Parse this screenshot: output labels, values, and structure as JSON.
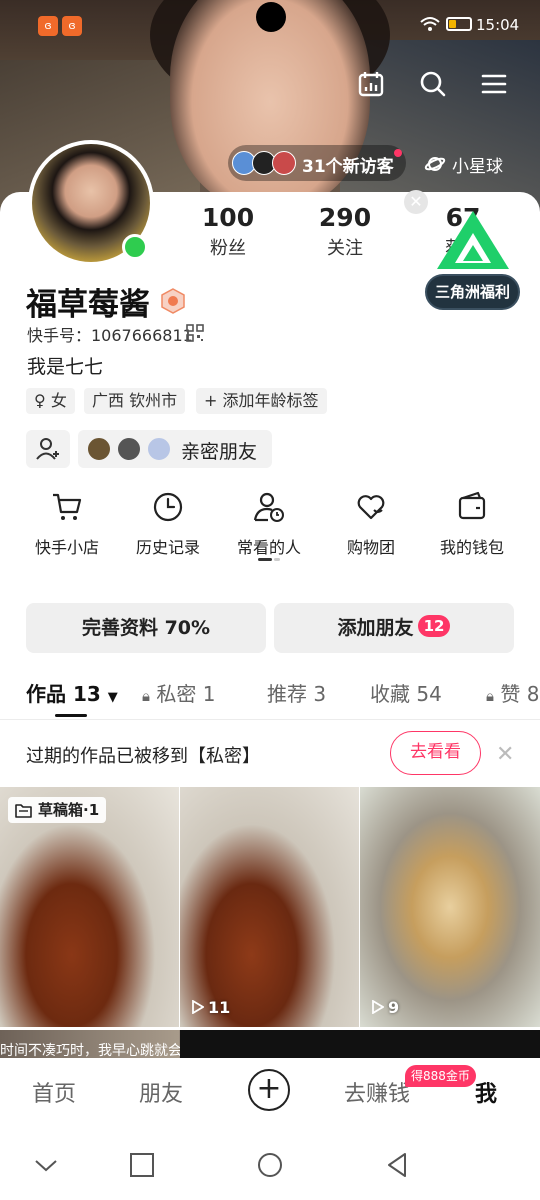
{
  "status_bar": {
    "app_icon_1": "bilibili-icon",
    "app_icon_2": "bilibili-icon",
    "time": "15:04"
  },
  "header": {
    "visitors_label": "31个新访客",
    "planet_label": "小星球"
  },
  "profile": {
    "stats": [
      {
        "value": "100",
        "label": "粉丝"
      },
      {
        "value": "290",
        "label": "关注"
      },
      {
        "value": "67",
        "label": "获赞"
      }
    ],
    "promo_label": "三角洲福利",
    "name": "福草莓酱",
    "kuaishou_id": "快手号：1067666811",
    "bio": "我是七七",
    "tags": [
      "女",
      "广西 钦州市",
      "添加年龄标签"
    ],
    "close_friends_label": "亲密朋友"
  },
  "tools": [
    {
      "label": "快手小店",
      "icon": "cart-icon"
    },
    {
      "label": "历史记录",
      "icon": "clock-icon"
    },
    {
      "label": "常看的人",
      "icon": "person-clock-icon"
    },
    {
      "label": "购物团",
      "icon": "heart-bag-icon"
    },
    {
      "label": "我的钱包",
      "icon": "wallet-icon"
    }
  ],
  "actions": {
    "complete_profile": "完善资料 70%",
    "add_friends": "添加朋友",
    "add_friends_badge": "12"
  },
  "content_tabs": [
    {
      "label": "作品 13",
      "active": true
    },
    {
      "label": "私密 1",
      "active": false
    },
    {
      "label": "推荐 3",
      "active": false
    },
    {
      "label": "收藏 54",
      "active": false
    },
    {
      "label": "赞 8",
      "active": false
    }
  ],
  "notice": {
    "text": "过期的作品已被移到【私密】",
    "button": "去看看"
  },
  "grid": [
    {
      "overlay": "草稿箱·1"
    },
    {
      "play_count": "11"
    },
    {
      "play_count": "9"
    }
  ],
  "peek_caption": "时间不凑巧时，我早心跳就会",
  "bottom_nav": {
    "home": "首页",
    "friends": "朋友",
    "earn": "去赚钱",
    "earn_badge": "得888金币",
    "me": "我"
  },
  "colors": {
    "accent": "#fe3666",
    "online": "#2fcc4f",
    "promo_green": "#1fcf6a"
  }
}
